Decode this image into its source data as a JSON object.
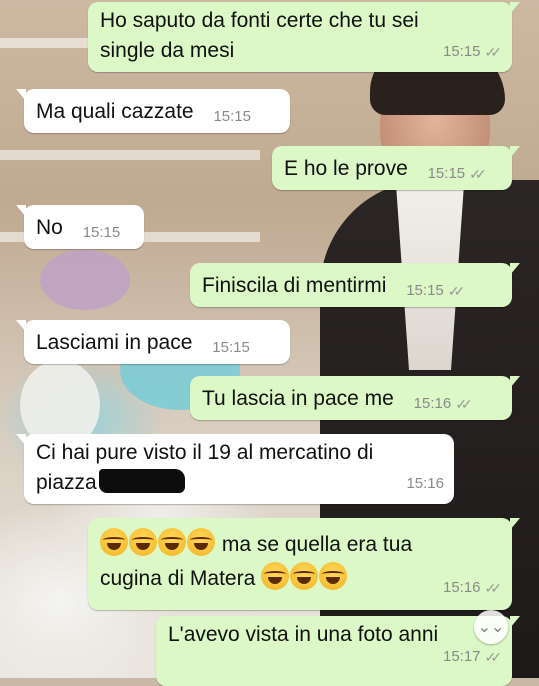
{
  "messages": [
    {
      "dir": "out",
      "text": "Ho saputo da fonti certe che tu sei single da mesi",
      "time": "15:15",
      "ticks": "✓✓"
    },
    {
      "dir": "in",
      "text": "Ma quali cazzate",
      "time": "15:15"
    },
    {
      "dir": "out",
      "text": "E ho le prove",
      "time": "15:15",
      "ticks": "✓✓"
    },
    {
      "dir": "in",
      "text": "No",
      "time": "15:15"
    },
    {
      "dir": "out",
      "text": "Finiscila di mentirmi",
      "time": "15:15",
      "ticks": "✓✓"
    },
    {
      "dir": "in",
      "text": "Lasciami in pace",
      "time": "15:15"
    },
    {
      "dir": "out",
      "text": "Tu lascia in pace me",
      "time": "15:16",
      "ticks": "✓✓"
    },
    {
      "dir": "in",
      "text_line1": "Ci hai pure visto il 19 al mercatino di",
      "text_line2": "piazza",
      "time": "15:16"
    },
    {
      "dir": "out",
      "text_line1": "ma se quella era tua",
      "text_line2": "cugina di Matera",
      "emoji_icon": "laughing-tears-emoji",
      "time": "15:16",
      "ticks": "✓✓"
    },
    {
      "dir": "out",
      "text": "L'avevo vista in una foto anni",
      "time": "15:17",
      "ticks": "✓✓"
    }
  ],
  "scroll_button": {
    "icon": "double-chevron-down-icon",
    "glyph": "⌄⌄"
  },
  "colors": {
    "incoming": "#ffffff",
    "outgoing": "#dcf8c6"
  }
}
